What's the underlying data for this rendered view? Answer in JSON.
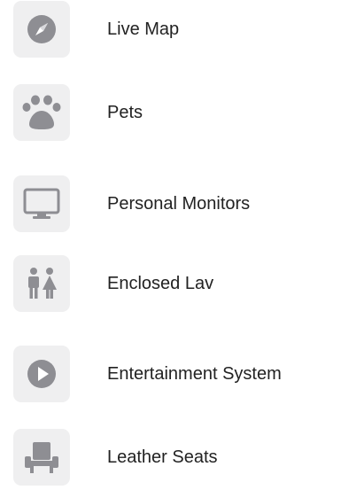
{
  "amenities": {
    "icon_color": "#8e8e93",
    "tile_color": "#efeff0",
    "items": [
      {
        "icon": "compass-icon",
        "label": "Live Map"
      },
      {
        "icon": "paw-icon",
        "label": "Pets"
      },
      {
        "icon": "monitor-icon",
        "label": "Personal Monitors"
      },
      {
        "icon": "restroom-icon",
        "label": "Enclosed Lav"
      },
      {
        "icon": "play-circle-icon",
        "label": "Entertainment System"
      },
      {
        "icon": "seat-icon",
        "label": "Leather Seats"
      }
    ]
  }
}
